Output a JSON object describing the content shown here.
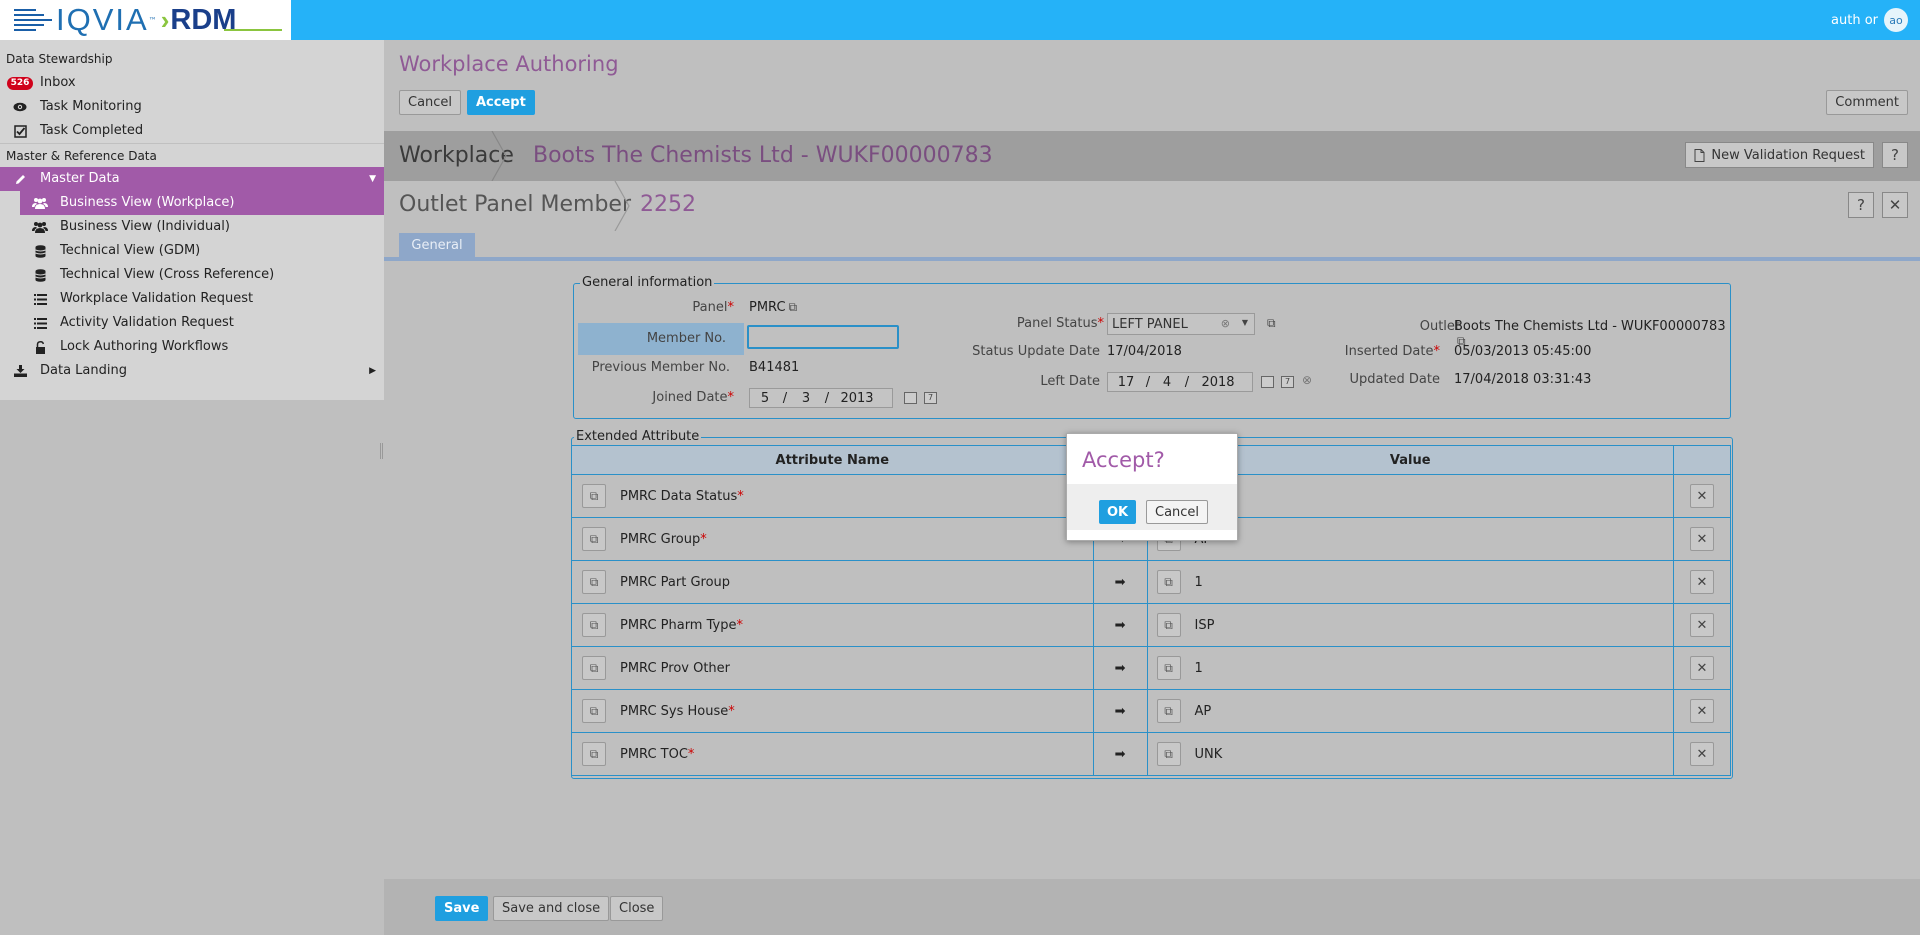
{
  "header": {
    "logo_text": "IQVIA",
    "logo_tm": "™",
    "logo_product": "RDM",
    "user_label": "auth or",
    "user_initials": "ao"
  },
  "sidebar": {
    "section_data_stewardship": "Data Stewardship",
    "inbox_badge": "526",
    "inbox_label": "Inbox",
    "task_monitoring": "Task Monitoring",
    "task_completed": "Task Completed",
    "section_master_reference": "Master & Reference Data",
    "master_data": "Master Data",
    "sub_items": [
      "Business View (Workplace)",
      "Business View (Individual)",
      "Technical View (GDM)",
      "Technical View (Cross Reference)",
      "Workplace Validation Request",
      "Activity Validation Request",
      "Lock Authoring Workflows"
    ],
    "data_landing": "Data Landing"
  },
  "main": {
    "page_title": "Workplace Authoring",
    "cancel_label": "Cancel",
    "accept_label": "Accept",
    "comment_label": "Comment",
    "workplace_label": "Workplace",
    "workplace_name": "Boots The Chemists Ltd - WUKF00000783",
    "new_validation_request": "New Validation Request",
    "help_label": "?",
    "close_label": "✕",
    "entity_label": "Outlet Panel Member",
    "entity_id": "2252",
    "tab_general": "General"
  },
  "general_info": {
    "legend": "General information",
    "panel_label": "Panel",
    "panel_value": "PMRC",
    "member_no_label": "Member No.",
    "member_no_value": "",
    "prev_member_label": "Previous Member No.",
    "prev_member_value": "B41481",
    "joined_date_label": "Joined Date",
    "joined_day": "5",
    "joined_month": "3",
    "joined_year": "2013",
    "panel_status_label": "Panel Status",
    "panel_status_value": "LEFT PANEL",
    "status_update_label": "Status Update Date",
    "status_update_value": "17/04/2018",
    "left_date_label": "Left Date",
    "left_day": "17",
    "left_month": "4",
    "left_year": "2018",
    "outlet_label": "Outlet",
    "outlet_value": "Boots The Chemists Ltd - WUKF00000783",
    "inserted_label": "Inserted Date",
    "inserted_value": "05/03/2013 05:45:00",
    "updated_label": "Updated Date",
    "updated_value": "17/04/2018 03:31:43",
    "date_sep": "/"
  },
  "extended": {
    "legend": "Extended Attribute",
    "col_name": "Attribute Name",
    "col_value": "Value",
    "rows": [
      {
        "name": "PMRC Data Status",
        "required": "*",
        "value": ""
      },
      {
        "name": "PMRC Group",
        "required": "*",
        "value": "AP"
      },
      {
        "name": "PMRC Part Group",
        "required": "",
        "value": "1"
      },
      {
        "name": "PMRC Pharm Type",
        "required": "*",
        "value": "ISP"
      },
      {
        "name": "PMRC Prov Other",
        "required": "",
        "value": "1"
      },
      {
        "name": "PMRC Sys House",
        "required": "*",
        "value": "AP"
      },
      {
        "name": "PMRC TOC",
        "required": "*",
        "value": "UNK"
      }
    ]
  },
  "footer": {
    "save": "Save",
    "save_and_close": "Save and close",
    "close": "Close"
  },
  "dialog": {
    "title": "Accept?",
    "ok": "OK",
    "cancel": "Cancel"
  },
  "colors": {
    "topbar": "#25b2f8",
    "accent_purple": "#a15aa8",
    "primary_button": "#1f9fe0",
    "fieldset_border": "#2a90c8"
  }
}
